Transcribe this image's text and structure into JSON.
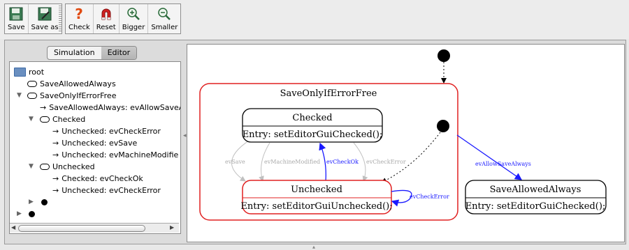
{
  "toolbar": {
    "buttons": [
      {
        "label": "Save",
        "icon": "floppy-disk-icon"
      },
      {
        "label": "Save as",
        "icon": "floppy-disk-pencil-icon"
      },
      {
        "label": "Check",
        "icon": "question-mark-icon"
      },
      {
        "label": "Reset",
        "icon": "magnet-icon"
      },
      {
        "label": "Bigger",
        "icon": "zoom-in-icon"
      },
      {
        "label": "Smaller",
        "icon": "zoom-out-icon"
      }
    ]
  },
  "tabs": [
    {
      "label": "Simulation",
      "active": false
    },
    {
      "label": "Editor",
      "active": true
    }
  ],
  "tree": {
    "root": "root",
    "items": [
      {
        "kind": "state",
        "label": "SaveAllowedAlways"
      },
      {
        "kind": "state",
        "label": "SaveOnlyIfErrorFree"
      },
      {
        "kind": "transition",
        "label": "SaveAllowedAlways: evAllowSaveA"
      },
      {
        "kind": "state",
        "label": "Checked"
      },
      {
        "kind": "transition",
        "label": "Unchecked: evCheckError"
      },
      {
        "kind": "transition",
        "label": "Unchecked: evSave"
      },
      {
        "kind": "transition",
        "label": "Unchecked: evMachineModifie"
      },
      {
        "kind": "state",
        "label": "Unchecked"
      },
      {
        "kind": "transition",
        "label": "Checked: evCheckOk"
      },
      {
        "kind": "transition",
        "label": "Unchecked: evCheckError"
      }
    ]
  },
  "diagram": {
    "composite_state": "SaveOnlyIfErrorFree",
    "states": {
      "checked": {
        "name": "Checked",
        "entry": "Entry: setEditorGuiChecked();"
      },
      "unchecked": {
        "name": "Unchecked",
        "entry": "Entry: setEditorGuiUnchecked();"
      },
      "save_allowed_always": {
        "name": "SaveAllowedAlways",
        "entry": "Entry: setEditorGuiChecked();"
      }
    },
    "transitions": {
      "ev_save": "evSave",
      "ev_machine_modified": "evMachineModified",
      "ev_check_ok": "evCheckOk",
      "ev_check_error_1": "evCheckError",
      "ev_check_error_2": "evCheckError",
      "ev_allow_save_always": "evAllowSaveAlways"
    },
    "colors": {
      "composite_border": "#e02020",
      "active_border": "#e02020",
      "active_transition": "#1a1aff",
      "inactive_transition": "#c0c0c0"
    }
  }
}
